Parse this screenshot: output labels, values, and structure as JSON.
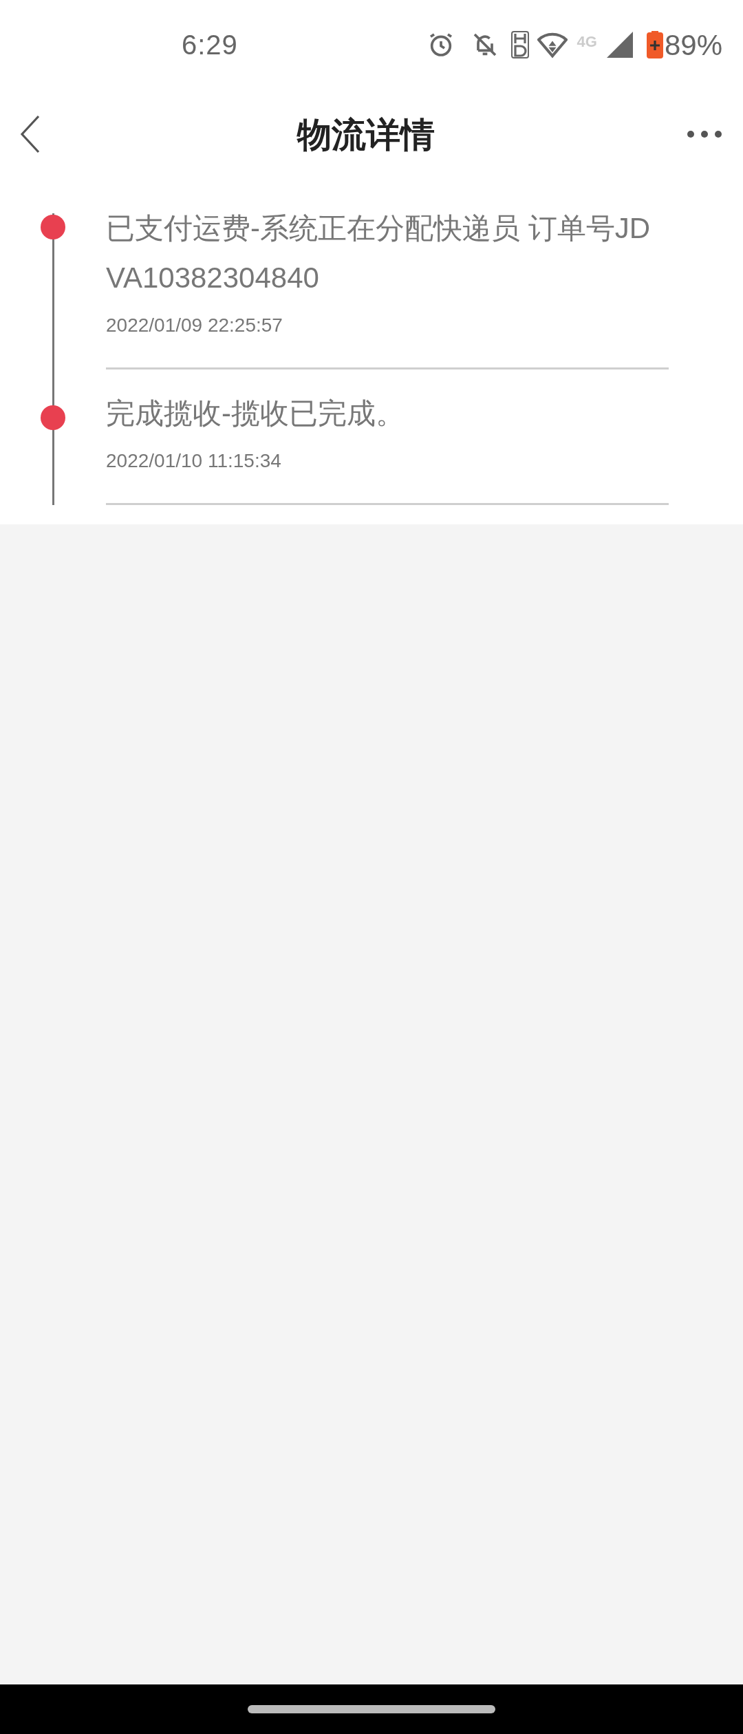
{
  "status_bar": {
    "time": "6:29",
    "network": "4G",
    "battery": "89%"
  },
  "header": {
    "title": "物流详情"
  },
  "events": [
    {
      "text": "已支付运费-系统正在分配快递员 订单号JDVA10382304840",
      "time": "2022/01/09 22:25:57"
    },
    {
      "text": "完成揽收-揽收已完成。",
      "time": "2022/01/10 11:15:34"
    }
  ]
}
